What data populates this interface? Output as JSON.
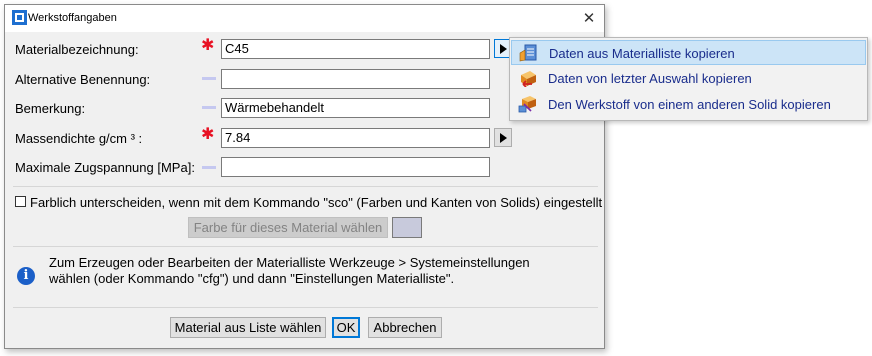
{
  "window": {
    "title": "Werkstoffangaben",
    "close_glyph": "✕"
  },
  "form": {
    "material_name": {
      "label": "Materialbezeichnung:",
      "value": "C45",
      "required_marker": "✱"
    },
    "alt_name": {
      "label": "Alternative Benennung:",
      "value": ""
    },
    "remark": {
      "label": "Bemerkung:",
      "value": "Wärmebehandelt"
    },
    "density": {
      "label": "Massendichte g/cm ³ :",
      "value": "7.84",
      "required_marker": "✱"
    },
    "tensile": {
      "label": "Maximale Zugspannung [MPa]:",
      "value": ""
    }
  },
  "color_option": {
    "checkbox_label": "Farblich unterscheiden, wenn mit dem Kommando \"sco\" (Farben und Kanten von Solids) eingestellt",
    "checked": false,
    "choose_color_button": "Farbe für dieses Material wählen",
    "swatch_color": "#c8cadc"
  },
  "info": {
    "icon": "info-icon",
    "text": "Zum Erzeugen oder Bearbeiten der Materialliste Werkzeuge > Systemeinstellungen wählen (oder Kommando \"cfg\") und dann \"Einstellungen Materialliste\"."
  },
  "buttons": {
    "choose_from_list": "Material aus Liste wählen",
    "ok": "OK",
    "cancel": "Abbrechen"
  },
  "context_menu": {
    "items": [
      {
        "label": "Daten aus Materialliste kopieren",
        "icon": "material-list-icon",
        "highlighted": true
      },
      {
        "label": "Daten von letzter Auswahl kopieren",
        "icon": "last-selection-icon",
        "highlighted": false
      },
      {
        "label": "Den Werkstoff von einem anderen Solid kopieren",
        "icon": "copy-from-solid-icon",
        "highlighted": false
      }
    ]
  },
  "colors": {
    "accent": "#0078d7",
    "required": "#e81123",
    "menu_text": "#1a2d8c",
    "menu_highlight": "#cce4f7"
  }
}
